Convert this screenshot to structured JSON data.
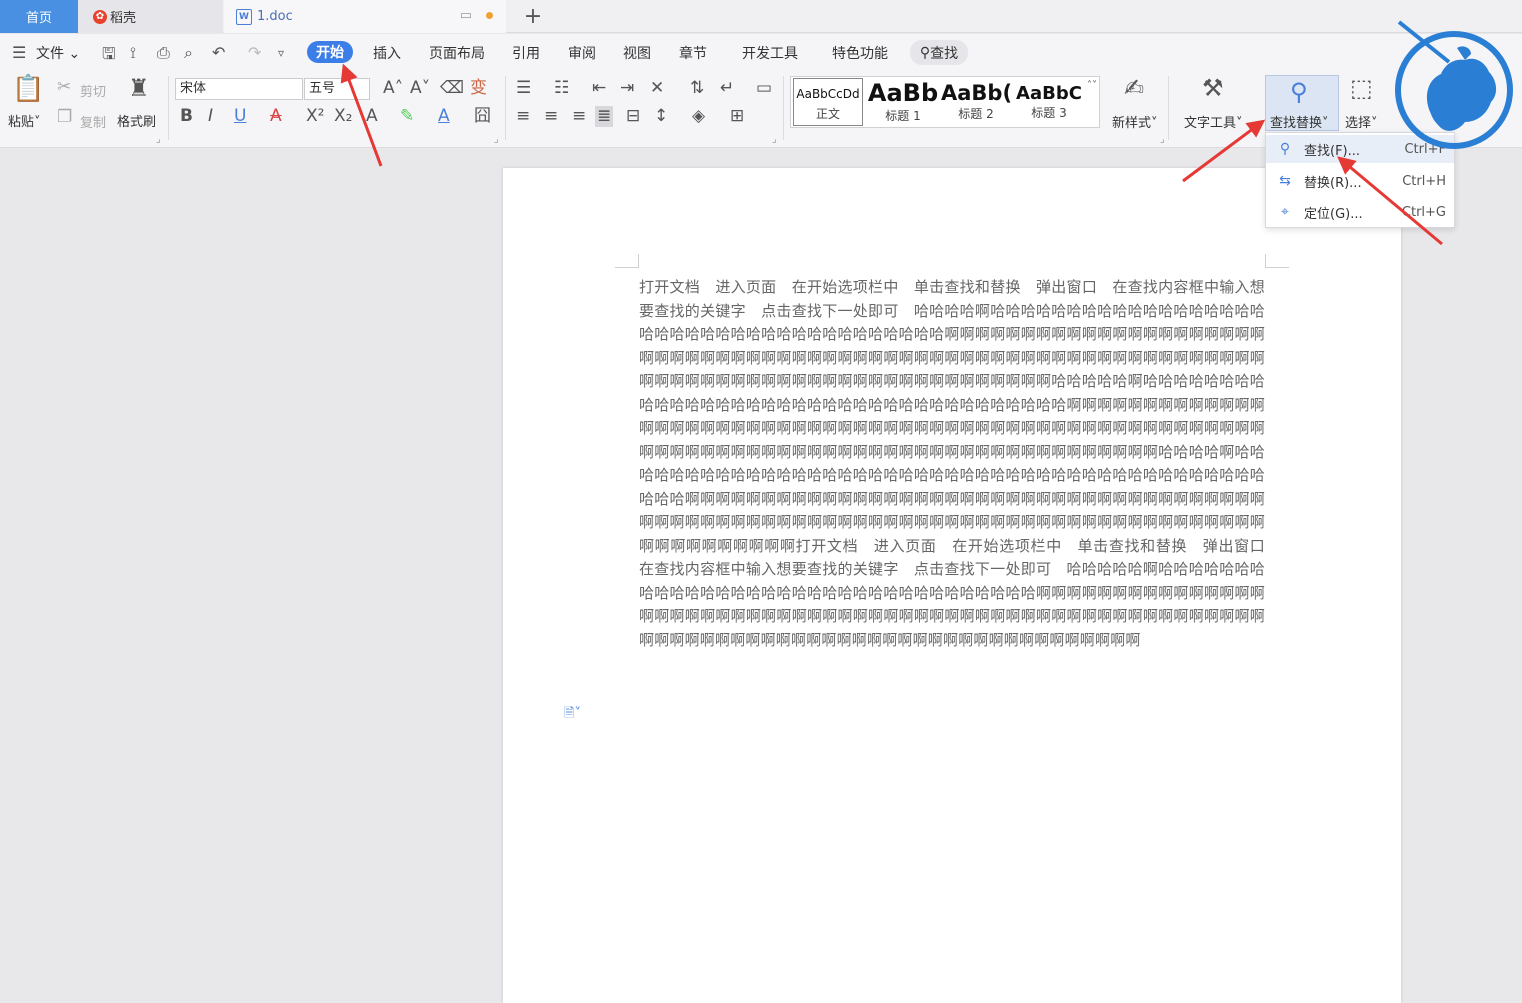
{
  "tabs": {
    "home": "首页",
    "docer": "稻壳",
    "doc": "1.doc",
    "add": "+"
  },
  "menubar": {
    "file": "文件",
    "items": [
      "开始",
      "插入",
      "页面布局",
      "引用",
      "审阅",
      "视图",
      "章节",
      "开发工具",
      "特色功能"
    ],
    "active": "开始",
    "search": "查找"
  },
  "ribbon": {
    "paste": "粘贴",
    "cut": "剪切",
    "copy": "复制",
    "format_painter": "格式刷",
    "font_name": "宋体",
    "font_size": "五号",
    "styles": [
      {
        "preview": "AaBbCcDd",
        "name": "正文"
      },
      {
        "preview": "AaBb",
        "name": "标题 1"
      },
      {
        "preview": "AaBb(",
        "name": "标题 2"
      },
      {
        "preview": "AaBbC",
        "name": "标题 3"
      }
    ],
    "new_style": "新样式",
    "text_tools": "文字工具",
    "find_replace": "查找替换",
    "select": "选择"
  },
  "dropdown": {
    "items": [
      {
        "label": "查找(F)...",
        "shortcut": "Ctrl+F",
        "icon": "search-icon"
      },
      {
        "label": "替换(R)...",
        "shortcut": "Ctrl+H",
        "icon": "replace-icon"
      },
      {
        "label": "定位(G)...",
        "shortcut": "Ctrl+G",
        "icon": "locate-icon"
      }
    ]
  },
  "document": {
    "text": "打开文档　进入页面　在开始选项栏中　单击查找和替换　弹出窗口　在查找内容框中输入想要查找的关键字　点击查找下一处即可　哈哈哈哈啊哈哈哈哈哈哈哈哈哈哈哈哈哈哈哈哈哈哈哈哈哈哈哈哈哈哈哈哈哈哈哈哈哈哈哈哈哈哈啊啊啊啊啊啊啊啊啊啊啊啊啊啊啊啊啊啊啊啊啊啊啊啊啊啊啊啊啊啊啊啊啊啊啊啊啊啊啊啊啊啊啊啊啊啊啊啊啊啊啊啊啊啊啊啊啊啊啊啊啊啊啊啊啊啊啊啊啊啊啊啊啊啊啊啊啊啊啊啊啊啊啊啊啊啊啊啊啊哈哈哈哈哈啊哈哈哈哈哈哈哈哈哈哈哈哈哈哈哈哈哈哈哈哈哈哈哈哈哈哈哈哈哈哈哈哈哈哈哈哈啊啊啊啊啊啊啊啊啊啊啊啊啊啊啊啊啊啊啊啊啊啊啊啊啊啊啊啊啊啊啊啊啊啊啊啊啊啊啊啊啊啊啊啊啊啊啊啊啊啊啊啊啊啊啊啊啊啊啊啊啊啊啊啊啊啊啊啊啊啊啊啊啊啊啊啊啊啊啊啊啊啊啊啊啊啊啊啊哈哈哈哈啊哈哈哈哈哈哈哈哈哈哈哈哈哈哈哈哈哈哈哈哈哈哈哈哈哈哈哈哈哈哈哈哈哈哈哈哈哈哈哈哈哈哈哈哈哈哈啊啊啊啊啊啊啊啊啊啊啊啊啊啊啊啊啊啊啊啊啊啊啊啊啊啊啊啊啊啊啊啊啊啊啊啊啊啊啊啊啊啊啊啊啊啊啊啊啊啊啊啊啊啊啊啊啊啊啊啊啊啊啊啊啊啊啊啊啊啊啊啊啊啊啊啊啊啊啊啊啊啊啊啊啊啊啊啊啊打开文档　进入页面　在开始选项栏中　单击查找和替换　弹出窗口　在查找内容框中输入想要查找的关键字　点击查找下一处即可　哈哈哈哈哈啊哈哈哈哈哈哈哈哈哈哈哈哈哈哈哈哈哈哈哈哈哈哈哈哈哈哈哈哈哈哈哈哈哈啊啊啊啊啊啊啊啊啊啊啊啊啊啊啊啊啊啊啊啊啊啊啊啊啊啊啊啊啊啊啊啊啊啊啊啊啊啊啊啊啊啊啊啊啊啊啊啊啊啊啊啊啊啊啊啊啊啊啊啊啊啊啊啊啊啊啊啊啊啊啊啊啊啊啊啊啊啊啊啊啊啊啊啊啊啊啊啊啊"
  },
  "colors": {
    "accent": "#3c7ee8",
    "annotation_arrow": "#e53935",
    "watermark": "#2a7fd4"
  }
}
